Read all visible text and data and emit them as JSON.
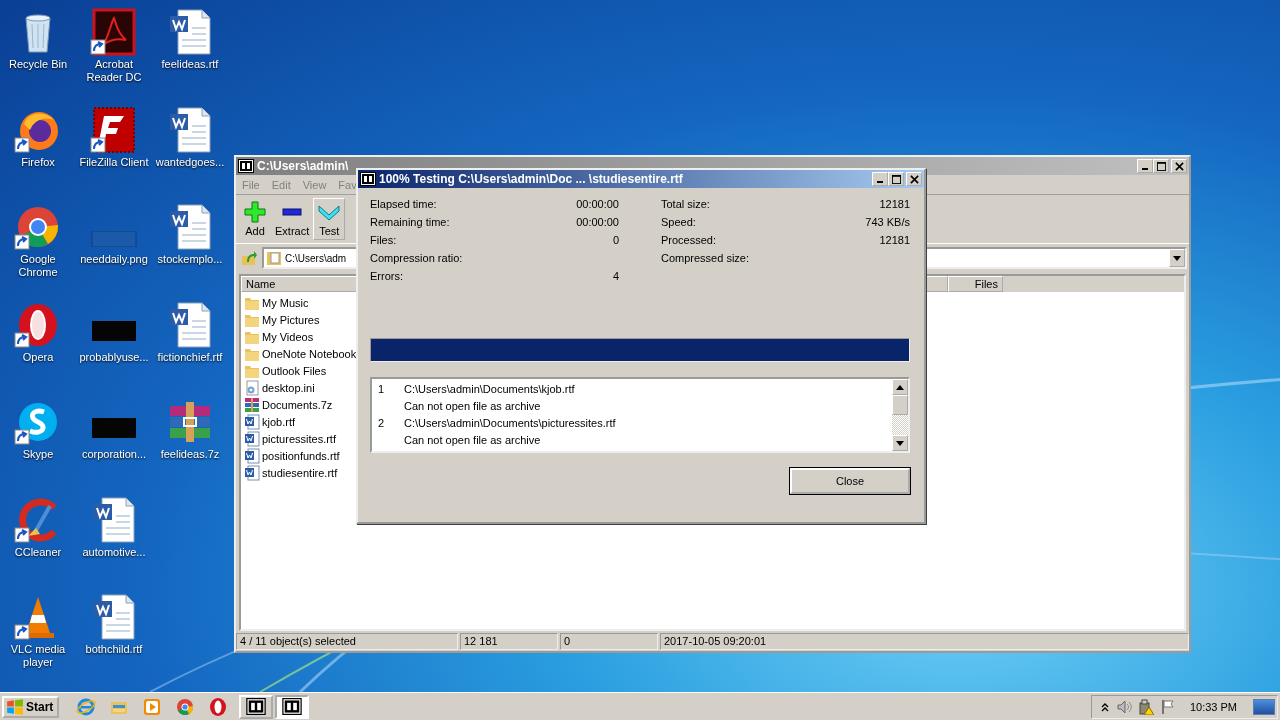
{
  "desktop": {
    "icons": [
      {
        "label": "Recycle Bin",
        "kind": "recycle",
        "shortcut": false
      },
      {
        "label": "Firefox",
        "kind": "firefox",
        "shortcut": true
      },
      {
        "label": "Google Chrome",
        "kind": "chrome",
        "shortcut": true
      },
      {
        "label": "Opera",
        "kind": "opera",
        "shortcut": true
      },
      {
        "label": "Skype",
        "kind": "skype",
        "shortcut": true
      },
      {
        "label": "CCleaner",
        "kind": "ccleaner",
        "shortcut": true
      },
      {
        "label": "VLC media player",
        "kind": "vlc",
        "shortcut": true
      },
      {
        "label": "Acrobat Reader DC",
        "kind": "acrobat",
        "shortcut": true
      },
      {
        "label": "FileZilla Client",
        "kind": "filezilla",
        "shortcut": true
      },
      {
        "label": "needdaily.png",
        "kind": "blank",
        "shortcut": false
      },
      {
        "label": "probablyuse...",
        "kind": "black",
        "shortcut": false
      },
      {
        "label": "corporation...",
        "kind": "black",
        "shortcut": false
      },
      {
        "label": "automotive...",
        "kind": "word",
        "shortcut": false
      },
      {
        "label": "bothchild.rtf",
        "kind": "word",
        "shortcut": false
      },
      {
        "label": "feelideas.rtf",
        "kind": "word",
        "shortcut": false
      },
      {
        "label": "wantedgoes...",
        "kind": "word",
        "shortcut": false
      },
      {
        "label": "stockemplo...",
        "kind": "word",
        "shortcut": false
      },
      {
        "label": "fictionchief.rtf",
        "kind": "word",
        "shortcut": false
      },
      {
        "label": "feelideas.7z",
        "kind": "winrar",
        "shortcut": false
      }
    ]
  },
  "main_window": {
    "title": "C:\\Users\\admin\\",
    "menu": [
      "File",
      "Edit",
      "View",
      "Fav"
    ],
    "toolbar": [
      {
        "label": "Add",
        "kind": "add"
      },
      {
        "label": "Extract",
        "kind": "extract"
      },
      {
        "label": "Test",
        "kind": "test"
      }
    ],
    "address": "C:\\Users\\adm",
    "columns": [
      "Name",
      "Files"
    ],
    "files": [
      {
        "name": "My Music",
        "kind": "folder"
      },
      {
        "name": "My Pictures",
        "kind": "folder"
      },
      {
        "name": "My Videos",
        "kind": "folder"
      },
      {
        "name": "OneNote Notebook",
        "kind": "folder"
      },
      {
        "name": "Outlook Files",
        "kind": "folder"
      },
      {
        "name": "desktop.ini",
        "kind": "ini"
      },
      {
        "name": "Documents.7z",
        "kind": "archive"
      },
      {
        "name": "kjob.rtf",
        "kind": "rtf"
      },
      {
        "name": "picturessites.rtf",
        "kind": "rtf"
      },
      {
        "name": "positionfunds.rtf",
        "kind": "rtf"
      },
      {
        "name": "studiesentire.rtf",
        "kind": "rtf"
      }
    ],
    "status_bar": [
      "4 / 11 object(s) selected",
      "12 181",
      "0",
      "2017-10-05 09:20:01"
    ]
  },
  "dialog": {
    "title": "100% Testing C:\\Users\\admin\\Doc ... \\studiesentire.rtf",
    "stats_left": [
      {
        "label": "Elapsed time:",
        "value": "00:00:00"
      },
      {
        "label": "Remaining time:",
        "value": "00:00:00"
      },
      {
        "label": "Files:",
        "value": "0"
      },
      {
        "label": "Compression ratio:"
      },
      {
        "label": "Errors:",
        "value": "4"
      }
    ],
    "stats_right": [
      {
        "label": "Total size:",
        "value": "12181"
      },
      {
        "label": "Speed:",
        "value": "743 KB/s"
      },
      {
        "label": "Processed:",
        "value": "12181"
      },
      {
        "label": "Compressed size:"
      }
    ],
    "progress": {
      "level": 1
    },
    "log": [
      {
        "number": "1",
        "text": "C:\\Users\\admin\\Documents\\kjob.rtf"
      },
      {
        "text": "Can not open file as archive"
      },
      {
        "number": "2",
        "text": "C:\\Users\\admin\\Documents\\picturessites.rtf"
      },
      {
        "text": "Can not open file as archive"
      }
    ],
    "buttons": [
      "Close"
    ]
  },
  "taskbar": {
    "start": "Start",
    "quick_launch": [
      {
        "kind": "ie"
      },
      {
        "kind": "folder"
      },
      {
        "kind": "media"
      },
      {
        "kind": "chrome"
      },
      {
        "kind": "opera"
      }
    ],
    "tasks": [
      {
        "selected": false
      },
      {
        "selected": true
      }
    ],
    "clock": "10:33 PM"
  }
}
